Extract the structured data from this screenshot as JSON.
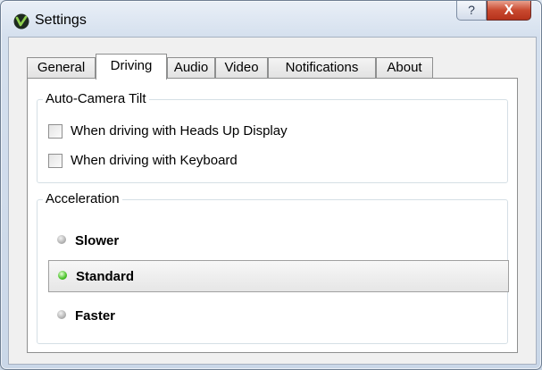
{
  "window": {
    "title": "Settings",
    "help_label": "?",
    "close_label": "X"
  },
  "tabs": [
    {
      "label": "General",
      "active": false
    },
    {
      "label": "Driving",
      "active": true
    },
    {
      "label": "Audio",
      "active": false
    },
    {
      "label": "Video",
      "active": false
    },
    {
      "label": "Notifications",
      "active": false
    },
    {
      "label": "About",
      "active": false
    }
  ],
  "camera_tilt": {
    "title": "Auto-Camera Tilt",
    "options": [
      {
        "label": "When driving with Heads Up Display",
        "checked": false
      },
      {
        "label": "When driving with Keyboard",
        "checked": false
      }
    ]
  },
  "acceleration": {
    "title": "Acceleration",
    "options": [
      {
        "label": "Slower",
        "selected": false
      },
      {
        "label": "Standard",
        "selected": true
      },
      {
        "label": "Faster",
        "selected": false
      }
    ]
  },
  "colors": {
    "led_on": "#48c227",
    "led_off": "#a9a9a9",
    "close_button": "#c9492f"
  }
}
